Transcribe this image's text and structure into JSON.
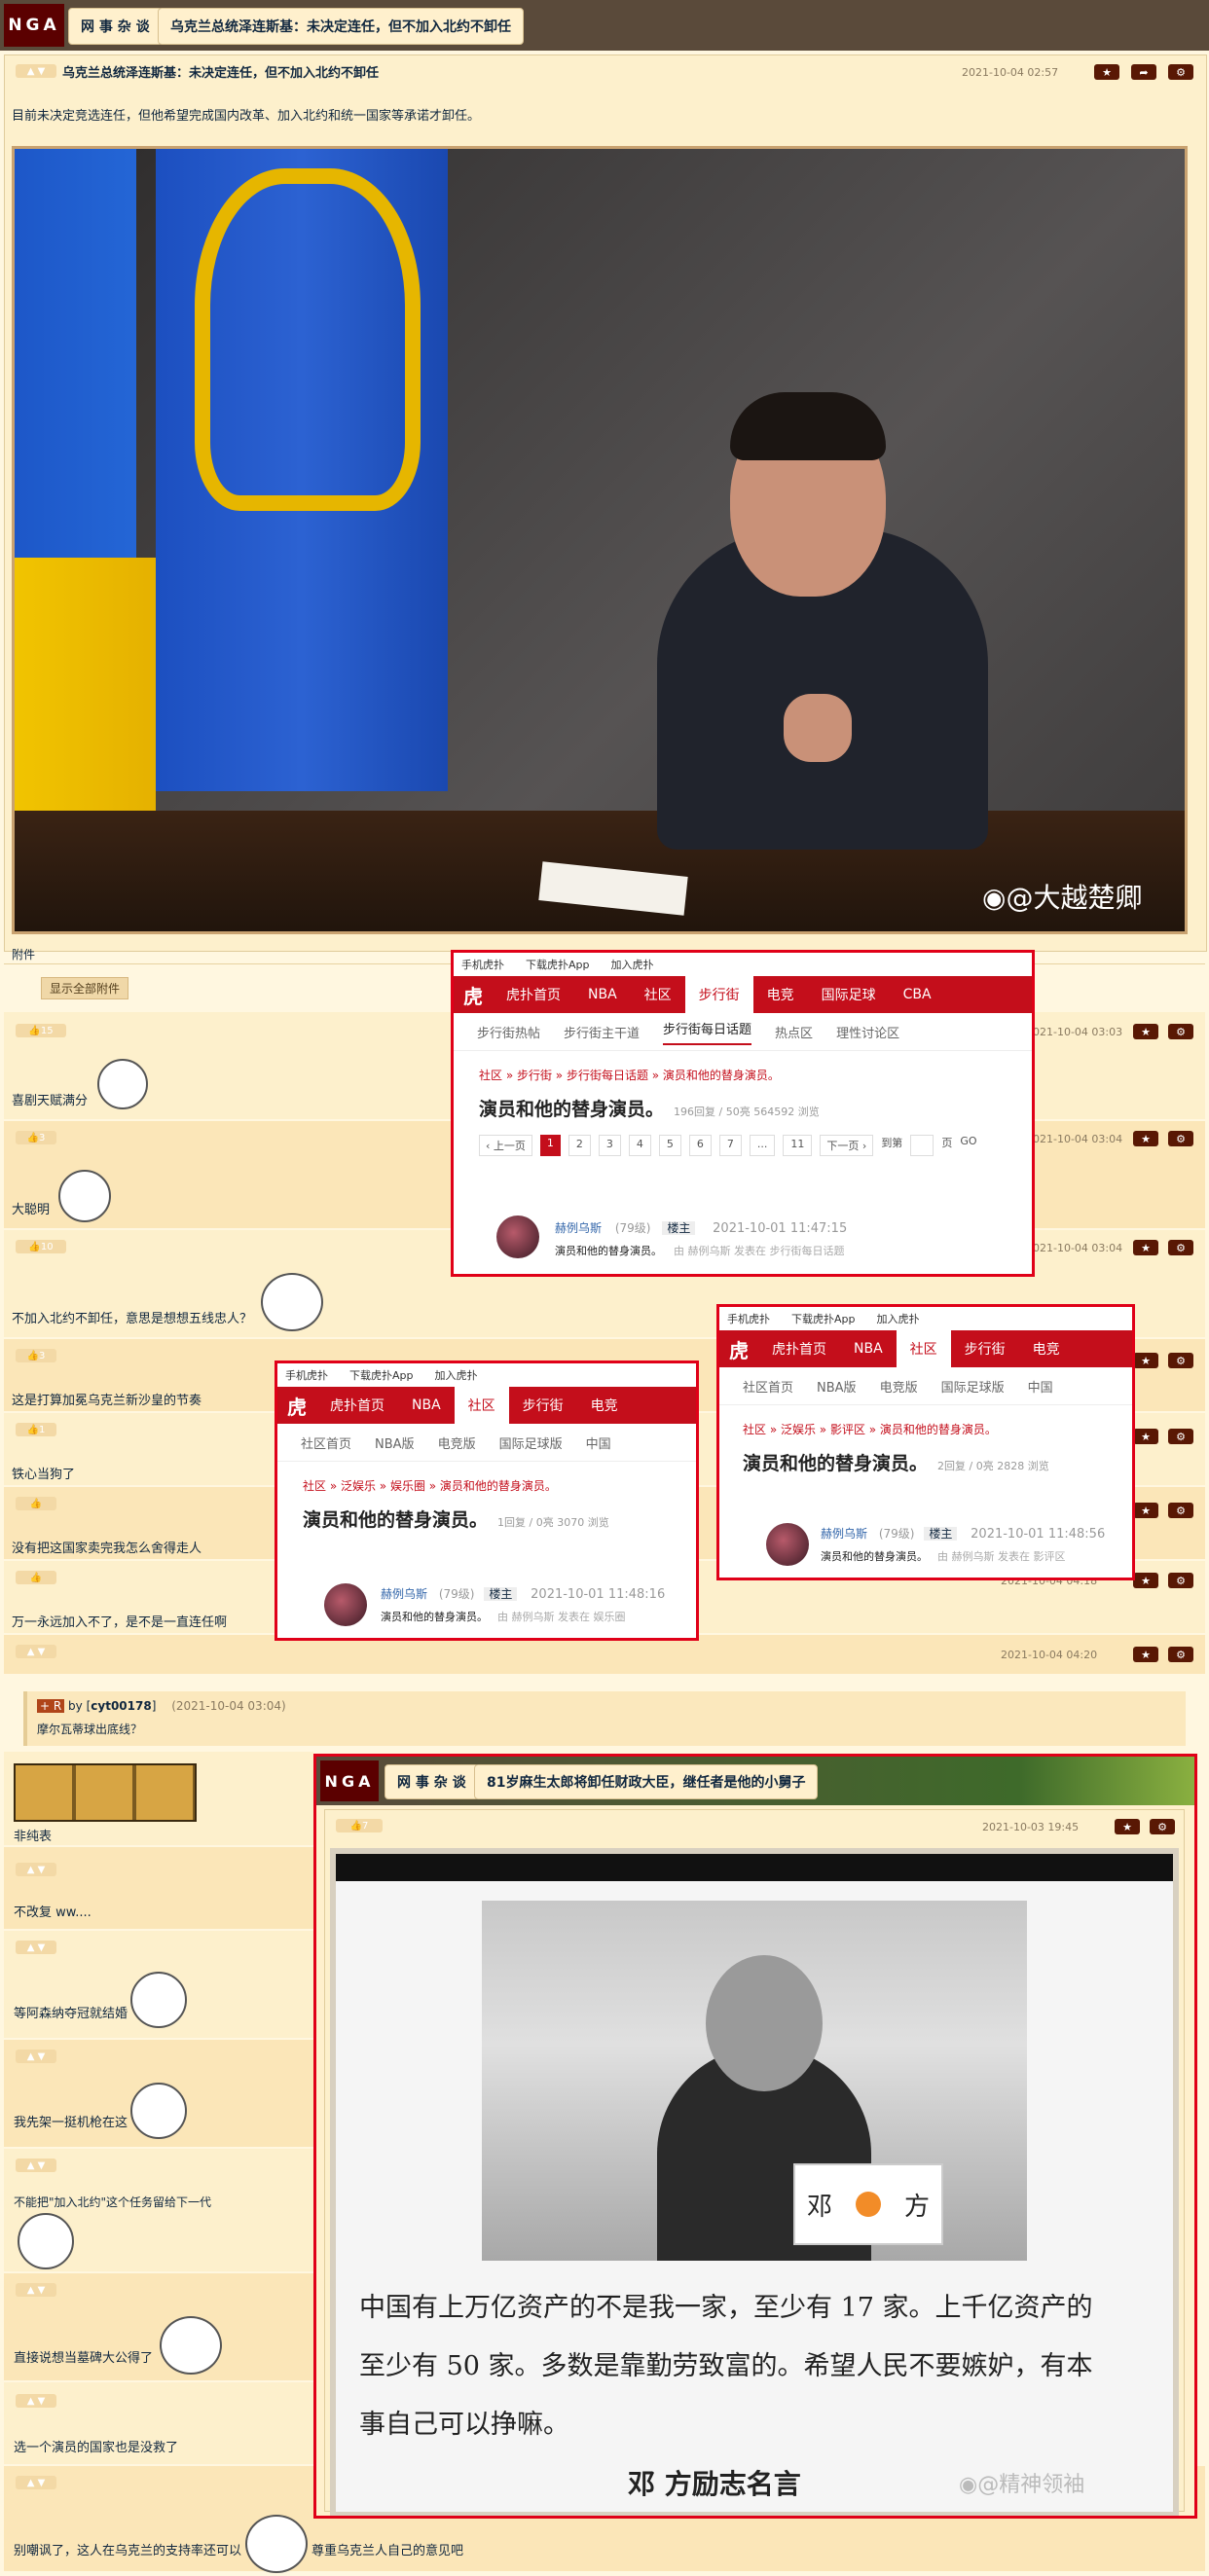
{
  "top": {
    "logo": "NGA",
    "forum": "网 事 杂 谈",
    "thread_title": "乌克兰总统泽连斯基：未决定连任，但不加入北约不卸任"
  },
  "main_post": {
    "title": "乌克兰总统泽连斯基：未决定连任，但不加入北约不卸任",
    "date": "2021-10-04 02:57",
    "body": "目前未决定竞选连任，但他希望完成国内改革、加入北约和统一国家等承诺才卸任。",
    "watermark": "@大越楚卿",
    "attach_label": "附件",
    "show_attach_button": "显示全部附件"
  },
  "replies": [
    {
      "likes": "15",
      "date": "2021-10-04 03:03",
      "text": "喜剧天赋满分"
    },
    {
      "likes": "3",
      "date": "2021-10-04 03:04",
      "text": "大聪明"
    },
    {
      "likes": "10",
      "date": "2021-10-04 03:04",
      "text": "不加入北约不卸任，意思是想想五线忠人？"
    },
    {
      "likes": "3",
      "date": "",
      "text": "这是打算加冕乌克兰新沙皇的节奏"
    },
    {
      "likes": "1",
      "date": "",
      "text": "铁心当狗了"
    },
    {
      "likes": "",
      "date": "",
      "text": "没有把这国家卖完我怎么舍得走人"
    },
    {
      "likes": "",
      "date": "2021-10-04 04:18",
      "text": "万一永远加入不了，是不是一直连任啊"
    },
    {
      "likes": "",
      "date": "2021-10-04 04:20",
      "text": ""
    }
  ],
  "quote": {
    "user": "cyt00178",
    "by": "by",
    "date": "(2021-10-04 03:04)",
    "text": "摩尔瓦蒂球出底线？"
  },
  "lower_replies": [
    {
      "text": "非纯表"
    },
    {
      "text": "不改复 ww...."
    },
    {
      "text": "等阿森纳夺冠就结婚"
    },
    {
      "text": "我先架一挺机枪在这"
    },
    {
      "text": "不能把\"加入北约\"这个任务留给下一代"
    },
    {
      "text": "直接说想当墓碑大公得了"
    },
    {
      "text": "选一个演员的国家也是没救了"
    },
    {
      "text": "别嘲讽了，这人在乌克兰的支持率还可以",
      "extra": "尊重乌克兰人自己的意见吧"
    }
  ],
  "hupu1": {
    "toplinks": [
      "手机虎扑",
      "下载虎扑App",
      "加入虎扑"
    ],
    "nav": [
      "虎扑首页",
      "NBA",
      "社区",
      "步行街",
      "电竞",
      "国际足球",
      "CBA"
    ],
    "active": "步行街",
    "sub": [
      "步行街热帖",
      "步行街主干道",
      "步行街每日话题",
      "热点区",
      "理性讨论区"
    ],
    "breadcrumb": "社区 » 步行街 » 步行街每日话题 » 演员和他的替身演员。",
    "title": "演员和他的替身演员。",
    "stats": "196回复 / 50亮 564592 浏览",
    "pager": [
      "‹ 上一页",
      "1",
      "2",
      "3",
      "4",
      "5",
      "6",
      "7",
      "...",
      "11",
      "下一页 ›",
      "到第",
      "页",
      "GO"
    ],
    "author": "赫例乌斯",
    "level": "(79级)",
    "badge": "楼主",
    "date": "2021-10-01 11:47:15",
    "text": "演员和他的替身演员。",
    "meta": "由 赫例乌斯 发表在 步行街每日话题"
  },
  "hupu2": {
    "toplinks": [
      "手机虎扑",
      "下载虎扑App",
      "加入虎扑"
    ],
    "nav": [
      "虎扑首页",
      "NBA",
      "社区",
      "步行街",
      "电竞"
    ],
    "active": "社区",
    "sub": [
      "社区首页",
      "NBA版",
      "电竞版",
      "国际足球版",
      "中国"
    ],
    "breadcrumb": "社区 » 泛娱乐 » 影评区 » 演员和他的替身演员。",
    "title": "演员和他的替身演员。",
    "stats": "2回复 / 0亮 2828 浏览",
    "author": "赫例乌斯",
    "level": "(79级)",
    "badge": "楼主",
    "date": "2021-10-01 11:48:56",
    "text": "演员和他的替身演员。",
    "meta": "由 赫例乌斯 发表在 影评区"
  },
  "hupu3": {
    "toplinks": [
      "手机虎扑",
      "下载虎扑App",
      "加入虎扑"
    ],
    "nav": [
      "虎扑首页",
      "NBA",
      "社区",
      "步行街",
      "电竞"
    ],
    "active": "社区",
    "sub": [
      "社区首页",
      "NBA版",
      "电竞版",
      "国际足球版",
      "中国"
    ],
    "breadcrumb": "社区 » 泛娱乐 » 娱乐圈 » 演员和他的替身演员。",
    "title": "演员和他的替身演员。",
    "stats": "1回复 / 0亮 3070 浏览",
    "author": "赫例乌斯",
    "level": "(79级)",
    "badge": "楼主",
    "date": "2021-10-01 11:48:16",
    "text": "演员和他的替身演员。",
    "meta": "由 赫例乌斯 发表在 娱乐圈"
  },
  "nga2": {
    "logo": "NGA",
    "forum": "网 事 杂 谈",
    "thread_title": "81岁麻生太郎将卸任财政大臣，继任者是他的小舅子",
    "likes": "7",
    "date": "2021-10-03 19:45",
    "nameplate_left": "邓",
    "nameplate_right": "方",
    "quote_line1": "中国有上万亿资产的不是我一家，至少有 17 家。上千亿资产的",
    "quote_line2": "至少有 50 家。多数是靠勤劳致富的。希望人民不要嫉妒，有本",
    "quote_line3": "事自己可以挣嘛。",
    "caption": "邓  方励志名言",
    "weibo": "@精神领袖"
  },
  "colors": {
    "nga_dark": "#591804",
    "page_bg": "#fff7e0",
    "hupu_red": "#c40e1b",
    "frame_red": "#e00018"
  }
}
